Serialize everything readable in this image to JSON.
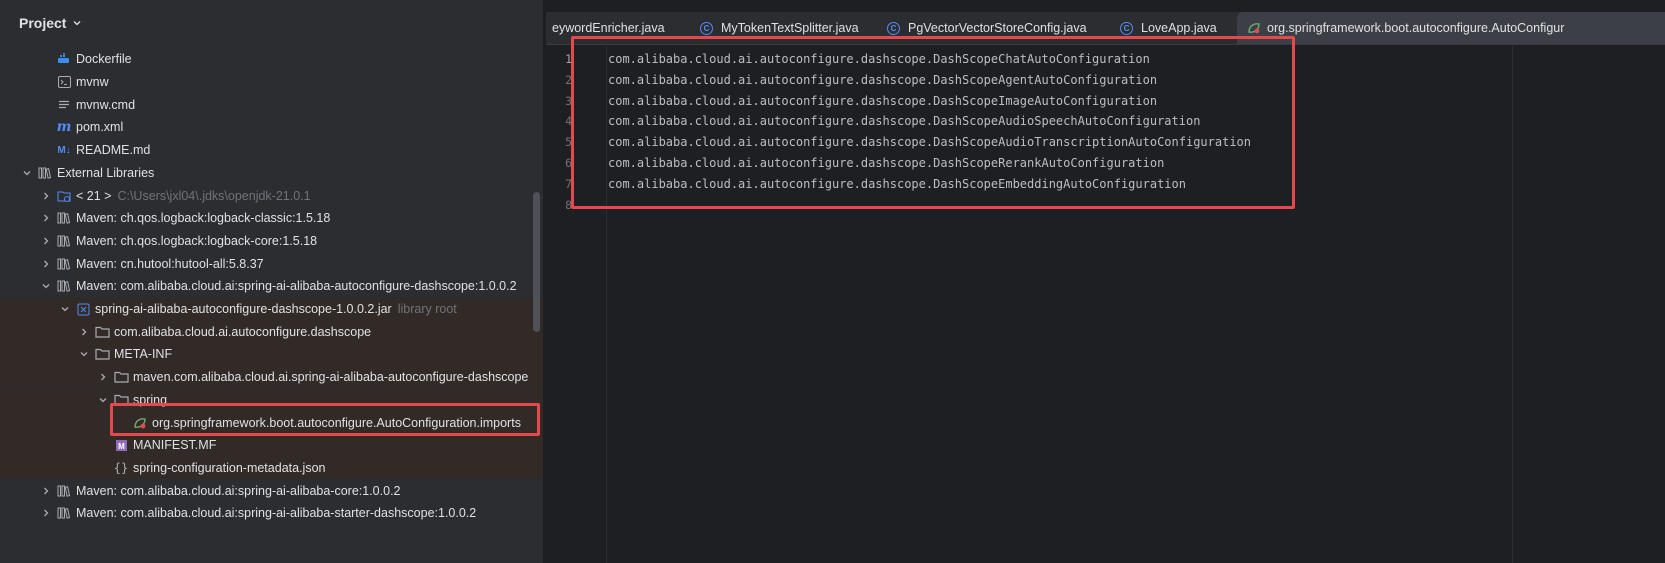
{
  "project_panel": {
    "title": "Project",
    "tree": [
      {
        "label": "Dockerfile",
        "icon": "docker-icon",
        "expanded": null
      },
      {
        "label": "mvnw",
        "icon": "terminal-file-icon",
        "expanded": null
      },
      {
        "label": "mvnw.cmd",
        "icon": "text-file-icon",
        "expanded": null
      },
      {
        "label": "pom.xml",
        "icon": "maven-icon",
        "expanded": null
      },
      {
        "label": "README.md",
        "icon": "markdown-icon",
        "expanded": null
      },
      {
        "label": "External Libraries",
        "icon": "library-icon",
        "expanded": true
      },
      {
        "label": "< 21 >",
        "suffix": "C:\\Users\\jxl04\\.jdks\\openjdk-21.0.1",
        "icon": "jdk-icon",
        "expanded": false
      },
      {
        "label": "Maven: ch.qos.logback:logback-classic:1.5.18",
        "icon": "library-icon",
        "expanded": false
      },
      {
        "label": "Maven: ch.qos.logback:logback-core:1.5.18",
        "icon": "library-icon",
        "expanded": false
      },
      {
        "label": "Maven: cn.hutool:hutool-all:5.8.37",
        "icon": "library-icon",
        "expanded": false
      },
      {
        "label": "Maven: com.alibaba.cloud.ai:spring-ai-alibaba-autoconfigure-dashscope:1.0.0.2",
        "icon": "library-icon",
        "expanded": true
      },
      {
        "label": "spring-ai-alibaba-autoconfigure-dashscope-1.0.0.2.jar",
        "suffix": "library root",
        "icon": "jar-icon",
        "expanded": true
      },
      {
        "label": "com.alibaba.cloud.ai.autoconfigure.dashscope",
        "icon": "folder-icon",
        "expanded": false
      },
      {
        "label": "META-INF",
        "icon": "folder-icon",
        "expanded": true
      },
      {
        "label": "maven.com.alibaba.cloud.ai.spring-ai-alibaba-autoconfigure-dashscope",
        "icon": "folder-icon",
        "expanded": false
      },
      {
        "label": "spring",
        "icon": "folder-icon",
        "expanded": true
      },
      {
        "label": "org.springframework.boot.autoconfigure.AutoConfiguration.imports",
        "icon": "spring-icon",
        "expanded": null
      },
      {
        "label": "MANIFEST.MF",
        "icon": "manifest-icon",
        "expanded": null
      },
      {
        "label": "spring-configuration-metadata.json",
        "icon": "json-icon",
        "expanded": null
      },
      {
        "label": "Maven: com.alibaba.cloud.ai:spring-ai-alibaba-core:1.0.0.2",
        "icon": "library-icon",
        "expanded": false
      },
      {
        "label": "Maven: com.alibaba.cloud.ai:spring-ai-alibaba-starter-dashscope:1.0.0.2",
        "icon": "library-icon",
        "expanded": false
      }
    ]
  },
  "editor": {
    "tabs": [
      {
        "label": "eywordEnricher.java",
        "icon": "",
        "active": false
      },
      {
        "label": "MyTokenTextSplitter.java",
        "icon": "class-icon",
        "active": false
      },
      {
        "label": "PgVectorVectorStoreConfig.java",
        "icon": "class-icon",
        "active": false
      },
      {
        "label": "LoveApp.java",
        "icon": "class-icon",
        "active": false
      },
      {
        "label": "org.springframework.boot.autoconfigure.AutoConfigur",
        "icon": "spring-icon",
        "active": true
      }
    ],
    "line_numbers": [
      "1",
      "2",
      "3",
      "4",
      "5",
      "6",
      "7",
      "8"
    ],
    "lines": [
      "com.alibaba.cloud.ai.autoconfigure.dashscope.DashScopeChatAutoConfiguration",
      "com.alibaba.cloud.ai.autoconfigure.dashscope.DashScopeAgentAutoConfiguration",
      "com.alibaba.cloud.ai.autoconfigure.dashscope.DashScopeImageAutoConfiguration",
      "com.alibaba.cloud.ai.autoconfigure.dashscope.DashScopeAudioSpeechAutoConfiguration",
      "com.alibaba.cloud.ai.autoconfigure.dashscope.DashScopeAudioTranscriptionAutoConfiguration",
      "com.alibaba.cloud.ai.autoconfigure.dashscope.DashScopeRerankAutoConfiguration",
      "com.alibaba.cloud.ai.autoconfigure.dashscope.DashScopeEmbeddingAutoConfiguration",
      ""
    ]
  },
  "colors": {
    "accent": "#548af7",
    "highlight_border": "#e5484d",
    "spring_green": "#6aab73"
  }
}
